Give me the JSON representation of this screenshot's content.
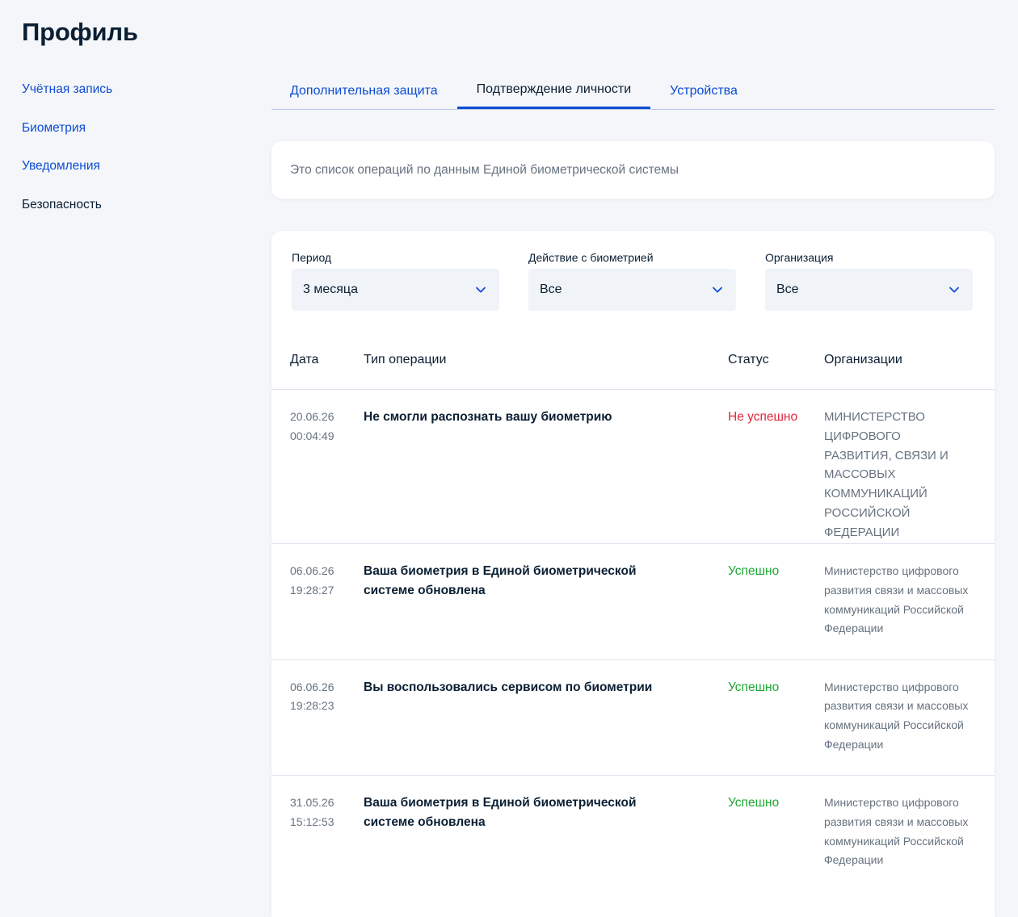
{
  "page": {
    "title": "Профиль"
  },
  "sidebar": {
    "items": [
      {
        "label": "Учётная запись",
        "active": false
      },
      {
        "label": "Биометрия",
        "active": false
      },
      {
        "label": "Уведомления",
        "active": false
      },
      {
        "label": "Безопасность",
        "active": true
      }
    ]
  },
  "tabs": [
    {
      "label": "Дополнительная защита",
      "active": false
    },
    {
      "label": "Подтверждение личности",
      "active": true
    },
    {
      "label": "Устройства",
      "active": false
    }
  ],
  "info": {
    "text": "Это список операций по данным Единой биометрической системы"
  },
  "filters": {
    "period": {
      "label": "Период",
      "value": "3 месяца"
    },
    "action": {
      "label": "Действие с биометрией",
      "value": "Все"
    },
    "organization": {
      "label": "Организация",
      "value": "Все"
    }
  },
  "table": {
    "headers": {
      "date": "Дата",
      "type": "Тип операции",
      "status": "Статус",
      "org": "Организации"
    },
    "rows": [
      {
        "date": "20.06.26",
        "time": "00:04:49",
        "type": "Не смогли распознать вашу биометрию",
        "status": "Не успешно",
        "status_kind": "fail",
        "org": "МИНИСТЕРСТВО ЦИФРОВОГО РАЗВИТИЯ, СВЯЗИ И МАССОВЫХ КОММУНИКАЦИЙ РОССИЙСКОЙ ФЕДЕРАЦИИ"
      },
      {
        "date": "06.06.26",
        "time": "19:28:27",
        "type": "Ваша биометрия в Единой биометрической системе обновлена",
        "status": "Успешно",
        "status_kind": "ok",
        "org": "Министерство цифрового развития связи и массовых коммуникаций Российской Федерации"
      },
      {
        "date": "06.06.26",
        "time": "19:28:23",
        "type": "Вы воспользовались сервисом по биометрии",
        "status": "Успешно",
        "status_kind": "ok",
        "org": "Министерство цифрового развития связи и массовых коммуникаций Российской Федерации"
      },
      {
        "date": "31.05.26",
        "time": "15:12:53",
        "type": "Ваша биометрия в Единой биометрической системе обновлена",
        "status": "Успешно",
        "status_kind": "ok",
        "org": "Министерство цифрового развития связи и массовых коммуникаций Российской Федерации"
      }
    ]
  },
  "colors": {
    "accent": "#0d4cd3",
    "text": "#0b1f33",
    "muted": "#66727f",
    "success": "#1ea833",
    "error": "#e3263d",
    "background": "#f4f6fa"
  },
  "icons": {
    "select_chevron": "chevron-down-icon"
  }
}
